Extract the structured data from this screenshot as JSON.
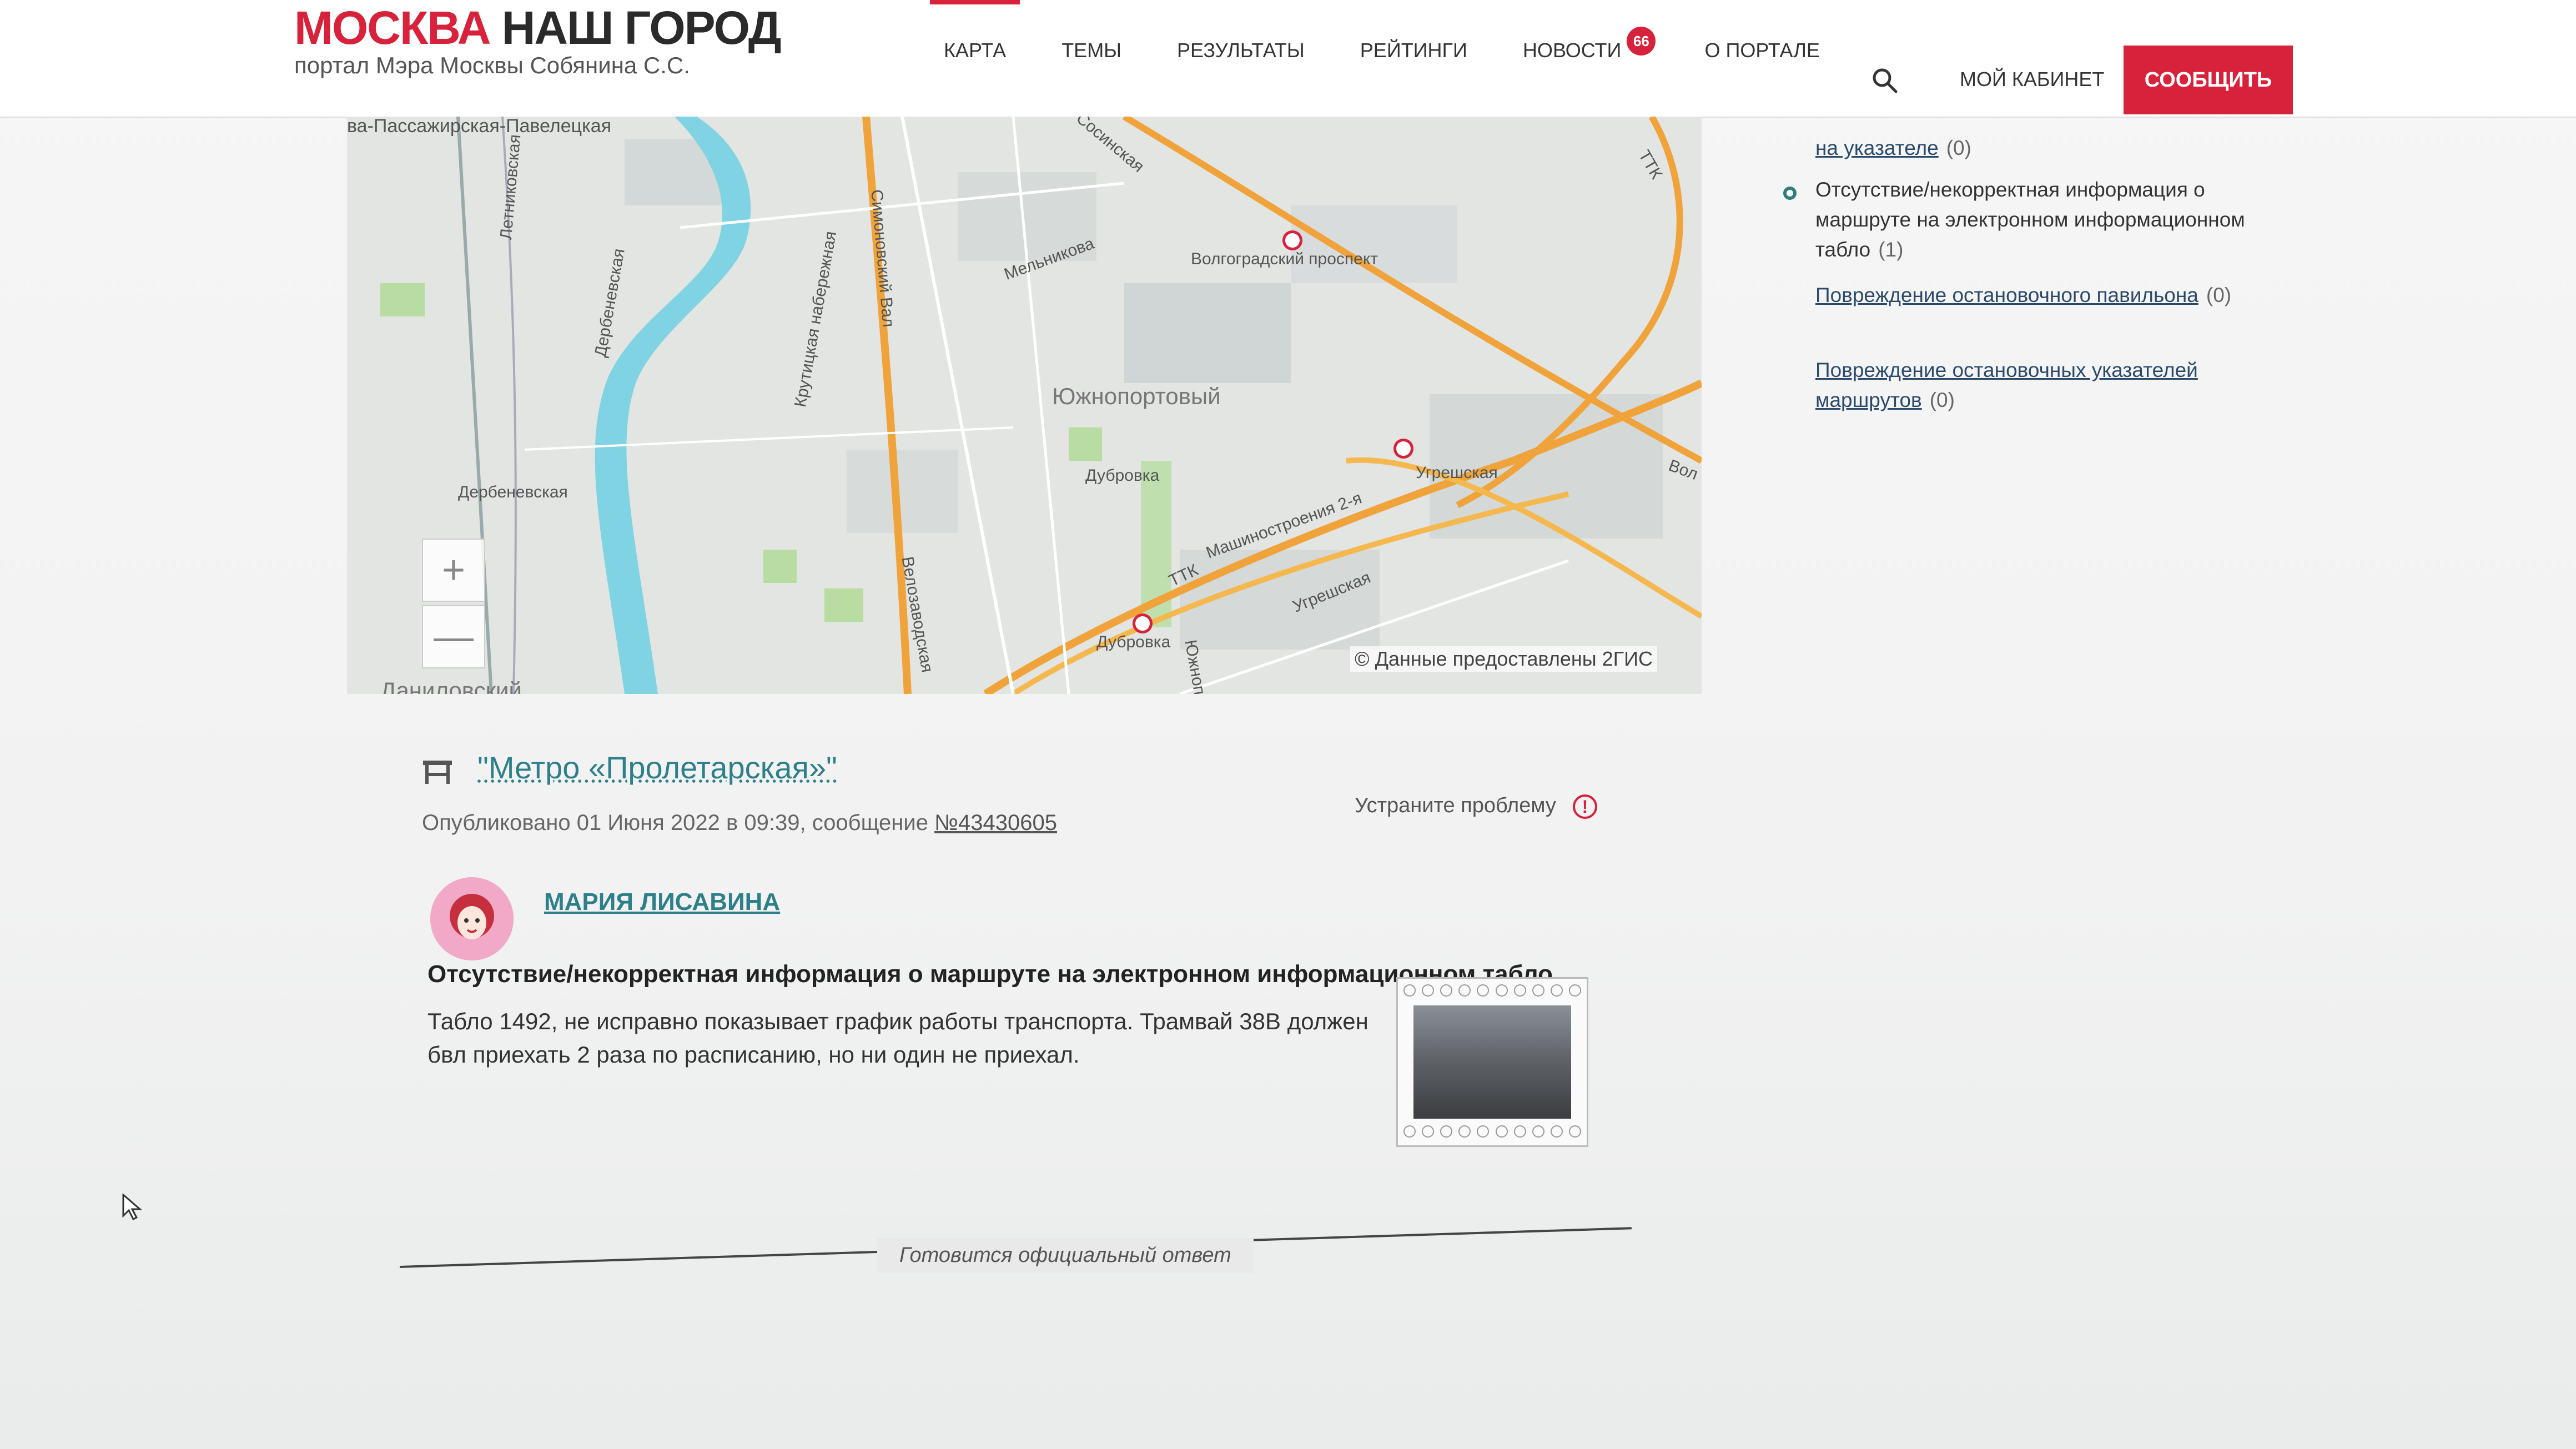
{
  "header": {
    "logo_red": "МОСКВА",
    "logo_dark": "НАШ ГОРОД",
    "logo_subtitle": "портал Мэра Москвы Собянина С.С.",
    "nav": [
      {
        "label": "КАРТА",
        "active": true
      },
      {
        "label": "ТЕМЫ",
        "active": false
      },
      {
        "label": "РЕЗУЛЬТАТЫ",
        "active": false
      },
      {
        "label": "РЕЙТИНГИ",
        "active": false
      },
      {
        "label": "НОВОСТИ",
        "active": false,
        "badge": "66"
      },
      {
        "label": "О ПОРТАЛЕ",
        "active": false
      }
    ],
    "search_icon": "search-icon",
    "cabinet_label": "МОЙ КАБИНЕТ",
    "report_label": "СООБЩИТЬ"
  },
  "map": {
    "labels": {
      "railway": "ва-Пассажирская-Павелецкая",
      "district": "Южнопортовый",
      "volgograd": "Волгоградский проспект",
      "melnikova": "Мельникова",
      "sosinskaya": "Сосинская",
      "letnikovskaya": "Летниковская",
      "derbenevskaya_st": "Дербеневская",
      "derbenevskaya": "Дербеневская",
      "naberezhnaya": "Крутицкая набережная",
      "simonovsky": "Симоновский Вал",
      "dubrovka": "Дубровка",
      "dubrovka_metro": "Дубровка",
      "mashinostroeniya": "Машиностроения 2-я",
      "ugreshskaya": "Угрешская",
      "ugreshskaya_street": "Угрешская",
      "ttk": "ТТК",
      "ttk2": "ТТК",
      "velozavodskaya": "Велозаводская",
      "yuzhnoportovaya": "Южноп",
      "danilovsky": "Даниловский",
      "vol": "Вол",
      "ttk3": "ТТК"
    },
    "zoom_in": "+",
    "zoom_out": "—",
    "copyright": "© Данные предоставлены 2ГИС"
  },
  "filters": [
    {
      "label": "на указателе",
      "count": "(0)",
      "selected": false
    },
    {
      "label": "Отсутствие/некорректная информация о маршруте на электронном информационном табло",
      "count": "(1)",
      "selected": true
    },
    {
      "label": "Повреждение остановочного павильона",
      "count": "(0)",
      "selected": false
    },
    {
      "label": "Повреждение остановочных указателей маршрутов",
      "count": "(0)",
      "selected": false
    }
  ],
  "message": {
    "title": "\"Метро «Пролетарская»\"",
    "published_prefix": "Опубликовано 01 Июня 2022 в 09:39, сообщение ",
    "number": "№43430605",
    "fix_label": "Устраните проблему",
    "fix_icon": "!",
    "author": "МАРИЯ ЛИСАВИНА",
    "problem": "Отсутствие/некорректная информация о маршруте на электронном информационном табло",
    "text": "Табло 1492, не исправно показывает график работы транспорта. Трамвай 38В должен бвл приехать 2 раза по расписанию, но ни один не приехал.",
    "status": "Готовится официальный ответ"
  },
  "colors": {
    "brand_red": "#d8213a",
    "link_teal": "#2d7f8a",
    "river": "#7fd3e2",
    "road_orange": "#f0a33a"
  }
}
